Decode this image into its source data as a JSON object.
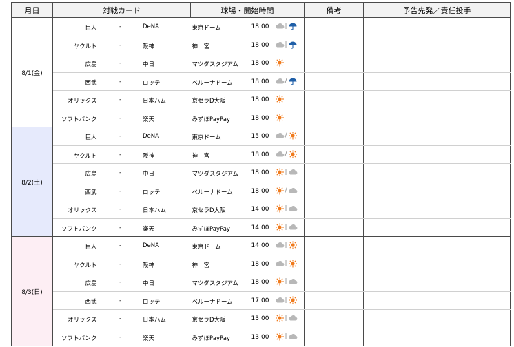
{
  "header": {
    "date": "月日",
    "card": "対戦カード",
    "venue": "球場・開始時間",
    "notes": "備考",
    "pitchers": "予告先発／責任投手"
  },
  "days": [
    {
      "date": "8/1(金)",
      "color": "#ffffff",
      "games": [
        {
          "home": "巨人",
          "sep": "-",
          "away": "DeNA",
          "stadium": "東京ドーム",
          "time": "18:00",
          "weather": [
            "cloud",
            "sep",
            "rain"
          ]
        },
        {
          "home": "ヤクルト",
          "sep": "-",
          "away": "阪神",
          "stadium": "神　宮",
          "time": "18:00",
          "weather": [
            "cloud",
            "sep",
            "rain"
          ]
        },
        {
          "home": "広島",
          "sep": "-",
          "away": "中日",
          "stadium": "マツダスタジアム",
          "time": "18:00",
          "weather": [
            "sun"
          ]
        },
        {
          "home": "西武",
          "sep": "-",
          "away": "ロッテ",
          "stadium": "ベルーナドーム",
          "time": "18:00",
          "weather": [
            "cloud",
            "slash",
            "rain"
          ]
        },
        {
          "home": "オリックス",
          "sep": "-",
          "away": "日本ハム",
          "stadium": "京セラD大阪",
          "time": "18:00",
          "weather": [
            "sun"
          ]
        },
        {
          "home": "ソフトバンク",
          "sep": "-",
          "away": "楽天",
          "stadium": "みずほPayPay",
          "time": "18:00",
          "weather": [
            "sun"
          ]
        }
      ]
    },
    {
      "date": "8/2(土)",
      "color": "#e6eafc",
      "games": [
        {
          "home": "巨人",
          "sep": "-",
          "away": "DeNA",
          "stadium": "東京ドーム",
          "time": "15:00",
          "weather": [
            "cloud",
            "slash",
            "sun"
          ]
        },
        {
          "home": "ヤクルト",
          "sep": "-",
          "away": "阪神",
          "stadium": "神　宮",
          "time": "18:00",
          "weather": [
            "cloud",
            "slash",
            "sun"
          ]
        },
        {
          "home": "広島",
          "sep": "-",
          "away": "中日",
          "stadium": "マツダスタジアム",
          "time": "18:00",
          "weather": [
            "sun",
            "sep",
            "cloud"
          ]
        },
        {
          "home": "西武",
          "sep": "-",
          "away": "ロッテ",
          "stadium": "ベルーナドーム",
          "time": "18:00",
          "weather": [
            "sun",
            "slash",
            "cloud"
          ]
        },
        {
          "home": "オリックス",
          "sep": "-",
          "away": "日本ハム",
          "stadium": "京セラD大阪",
          "time": "14:00",
          "weather": [
            "sun",
            "sep",
            "cloud"
          ]
        },
        {
          "home": "ソフトバンク",
          "sep": "-",
          "away": "楽天",
          "stadium": "みずほPayPay",
          "time": "14:00",
          "weather": [
            "sun",
            "sep",
            "cloud"
          ]
        }
      ]
    },
    {
      "date": "8/3(日)",
      "color": "#fdeef4",
      "games": [
        {
          "home": "巨人",
          "sep": "-",
          "away": "DeNA",
          "stadium": "東京ドーム",
          "time": "14:00",
          "weather": [
            "cloud",
            "sep",
            "sun"
          ]
        },
        {
          "home": "ヤクルト",
          "sep": "-",
          "away": "阪神",
          "stadium": "神　宮",
          "time": "18:00",
          "weather": [
            "cloud",
            "sep",
            "sun"
          ]
        },
        {
          "home": "広島",
          "sep": "-",
          "away": "中日",
          "stadium": "マツダスタジアム",
          "time": "18:00",
          "weather": [
            "sun",
            "sep",
            "cloud"
          ]
        },
        {
          "home": "西武",
          "sep": "-",
          "away": "ロッテ",
          "stadium": "ベルーナドーム",
          "time": "17:00",
          "weather": [
            "cloud",
            "sep",
            "sun"
          ]
        },
        {
          "home": "オリックス",
          "sep": "-",
          "away": "日本ハム",
          "stadium": "京セラD大阪",
          "time": "13:00",
          "weather": [
            "sun",
            "sep",
            "cloud"
          ]
        },
        {
          "home": "ソフトバンク",
          "sep": "-",
          "away": "楽天",
          "stadium": "みずほPayPay",
          "time": "13:00",
          "weather": [
            "sun",
            "sep",
            "cloud"
          ]
        }
      ]
    }
  ],
  "colors": {
    "sun": "#f07a1c",
    "cloud": "#b8b8b8",
    "rain": "#1f5fa8"
  }
}
